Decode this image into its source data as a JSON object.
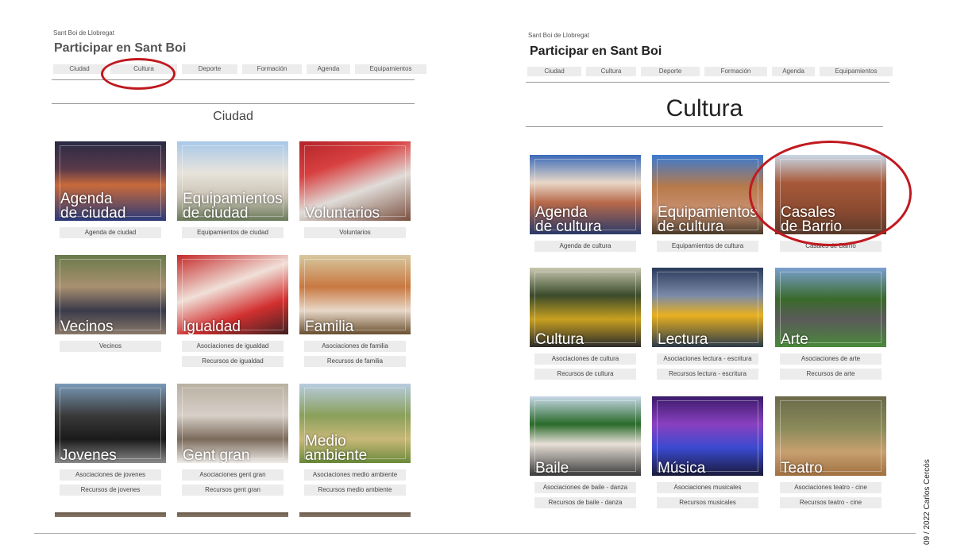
{
  "left": {
    "site_name": "Sant Boi de Llobregat",
    "site_title": "Participar en Sant Boi",
    "nav": [
      "Ciudad",
      "Cultura",
      "Deporte",
      "Formación",
      "Agenda",
      "Equipamientos"
    ],
    "heading": "Ciudad",
    "tiles": [
      {
        "label": "Agenda\nde ciudad",
        "buttons": [
          "Agenda de ciudad"
        ]
      },
      {
        "label": "Equipamientos\nde ciudad",
        "buttons": [
          "Equipamientos de ciudad"
        ]
      },
      {
        "label": "Voluntarios",
        "buttons": [
          "Voluntarios"
        ]
      },
      {
        "label": "Vecinos",
        "buttons": [
          "Vecinos"
        ]
      },
      {
        "label": "Igualdad",
        "buttons": [
          "Asociaciones de igualdad",
          "Recursos de igualdad"
        ]
      },
      {
        "label": "Familia",
        "buttons": [
          "Asociaciones de familia",
          "Recursos de familia"
        ]
      },
      {
        "label": "Jovenes",
        "buttons": [
          "Asociaciones de jovenes",
          "Recursos de jovenes"
        ]
      },
      {
        "label": "Gent gran",
        "buttons": [
          "Asociaciones gent gran",
          "Recursos gent gran"
        ]
      },
      {
        "label": "Medio\nambiente",
        "buttons": [
          "Asociaciones medio ambiente",
          "Recursos medio ambiente"
        ]
      }
    ]
  },
  "right": {
    "site_name": "Sant Boi de Llobregat",
    "site_title": "Participar en Sant Boi",
    "nav": [
      "Ciudad",
      "Cultura",
      "Deporte",
      "Formación",
      "Agenda",
      "Equipamientos"
    ],
    "heading": "Cultura",
    "tiles": [
      {
        "label": "Agenda\nde cultura",
        "buttons": [
          "Agenda de cultura"
        ]
      },
      {
        "label": "Equipamientos\nde cultura",
        "buttons": [
          "Equipamientos de cultura"
        ]
      },
      {
        "label": "Casales\nde Barrio",
        "buttons": [
          "Casales de Barrio"
        ]
      },
      {
        "label": "Cultura",
        "buttons": [
          "Asociaciones de cultura",
          "Recursos de cultura"
        ]
      },
      {
        "label": "Lectura",
        "buttons": [
          "Asociaciones lectura - escritura",
          "Recursos lectura - escritura"
        ]
      },
      {
        "label": "Arte",
        "buttons": [
          "Asociaciones de arte",
          "Recursos de arte"
        ]
      },
      {
        "label": "Baile",
        "buttons": [
          "Asociaciones de baile - danza",
          "Recursos de baile - danza"
        ]
      },
      {
        "label": "Música",
        "buttons": [
          "Asociaciones musicales",
          "Recursos musicales"
        ]
      },
      {
        "label": "Teatro",
        "buttons": [
          "Asociaciones teatro - cine",
          "Recursos teatro - cine"
        ]
      }
    ]
  },
  "credit": "09 / 2022  Carlos Cercós",
  "colors": {
    "highlight_oval": "#c0191f",
    "button_bg": "#ececec"
  }
}
